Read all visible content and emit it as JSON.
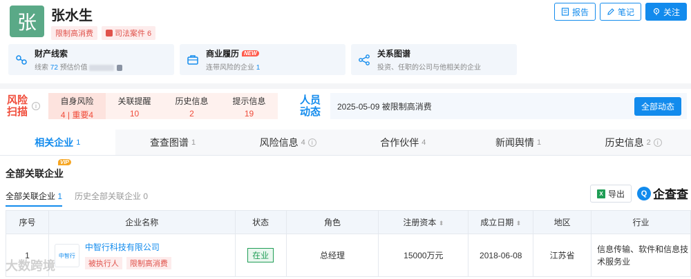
{
  "person": {
    "avatar_char": "张",
    "name": "张水生",
    "tags": [
      "限制高消费",
      "司法案件 6"
    ]
  },
  "actions": {
    "report": "报告",
    "note": "笔记",
    "follow": "关注"
  },
  "cards": [
    {
      "title": "财产线索",
      "sub_prefix": "线索",
      "sub_num": "72",
      "sub_suffix": "预估价值"
    },
    {
      "title": "商业履历",
      "badge": "NEW",
      "sub_prefix": "连带风险的企业",
      "sub_num": "1"
    },
    {
      "title": "关系图谱",
      "sub_prefix": "投资、任职的公司与他相关的企业"
    }
  ],
  "risk_scan": {
    "logo_line1": "风险",
    "logo_line2": "扫描",
    "items": [
      {
        "label": "自身风险",
        "count": "4 | 重要4"
      },
      {
        "label": "关联提醒",
        "count": "10"
      },
      {
        "label": "历史信息",
        "count": "2"
      },
      {
        "label": "提示信息",
        "count": "19"
      }
    ]
  },
  "people_dynamics": {
    "logo_line1": "人员",
    "logo_line2": "动态",
    "text": "2025-05-09 被限制高消费",
    "button": "全部动态"
  },
  "tabs": [
    {
      "label": "相关企业",
      "count": "1"
    },
    {
      "label": "查查图谱",
      "count": "1"
    },
    {
      "label": "风险信息",
      "count": "4"
    },
    {
      "label": "合作伙伴",
      "count": "4"
    },
    {
      "label": "新闻舆情",
      "count": "1"
    },
    {
      "label": "历史信息",
      "count": "2"
    }
  ],
  "section": {
    "title": "全部关联企业",
    "vip": "VIP",
    "subtabs": [
      {
        "label": "全部关联企业",
        "count": "1"
      },
      {
        "label": "历史全部关联企业",
        "count": "0"
      }
    ],
    "export": "导出",
    "brand": "企查查"
  },
  "table": {
    "headers": [
      "序号",
      "企业名称",
      "状态",
      "角色",
      "注册资本",
      "成立日期",
      "地区",
      "行业"
    ],
    "rows": [
      {
        "index": "1",
        "logo_text": "中智行",
        "company": "中智行科技有限公司",
        "tags": [
          "被执行人",
          "限制高消费"
        ],
        "status": "在业",
        "role": "总经理",
        "capital": "15000万元",
        "founded": "2018-06-08",
        "region": "江苏省",
        "industry": "信息传输、软件和信息技术服务业"
      }
    ]
  },
  "watermark": "大数跨境",
  "colors": {
    "accent": "#128bed",
    "risk": "#f04c3a",
    "avatar": "#5aa987"
  }
}
